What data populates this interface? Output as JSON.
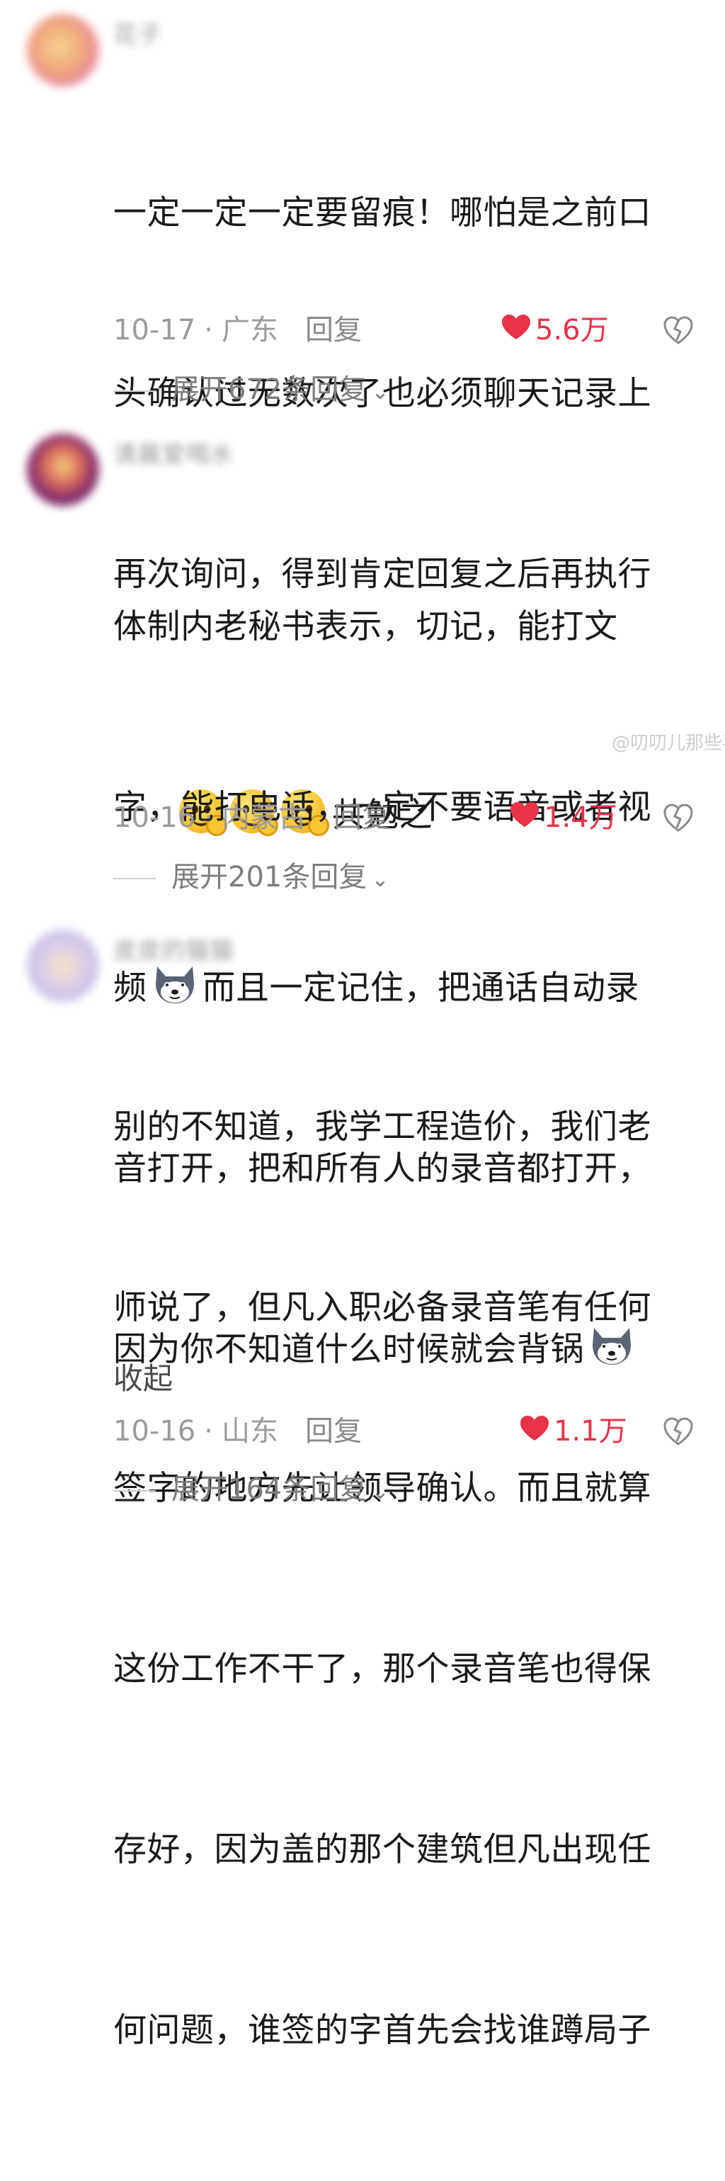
{
  "watermark": "@叨叨儿那些事聊",
  "comments": [
    {
      "username": "花子",
      "lines": [
        "一定一定一定要留痕！哪怕是之前口",
        "头确认过无数次了也必须聊天记录上",
        "再次询问，得到肯定回复之后再执行"
      ],
      "last_line_text": "共勉之",
      "date": "10-17",
      "location": "广东",
      "reply_label": "回复",
      "likes": "5.6万",
      "expand_label": "展开672条回复"
    },
    {
      "username": "清晨爱喝水",
      "lines": [
        "体制内老秘书表示，切记，能打文",
        "字，能打电话，一定不要语音或者视"
      ],
      "line3_pre": "频",
      "line3_post": "而且一定记住，把通话自动录",
      "line4": "音打开，把和所有人的录音都打开，",
      "line5": "因为你不知道什么时候就会背锅",
      "date": "10-16",
      "location": "内蒙古",
      "reply_label": "回复",
      "likes": "1.4万",
      "expand_label": "展开201条回复"
    },
    {
      "username": "皮皮的猫猫",
      "lines": [
        "别的不知道，我学工程造价，我们老",
        "师说了，但凡入职必备录音笔有任何",
        "签字的地方先让领导确认。而且就算",
        "这份工作不干了，那个录音笔也得保",
        "存好，因为盖的那个建筑但凡出现任",
        "何问题，谁签的字首先会找谁蹲局子"
      ],
      "collapse_label": "收起",
      "date": "10-16",
      "location": "山东",
      "reply_label": "回复",
      "likes": "1.1万",
      "expand_label": "展开164条回复"
    }
  ]
}
